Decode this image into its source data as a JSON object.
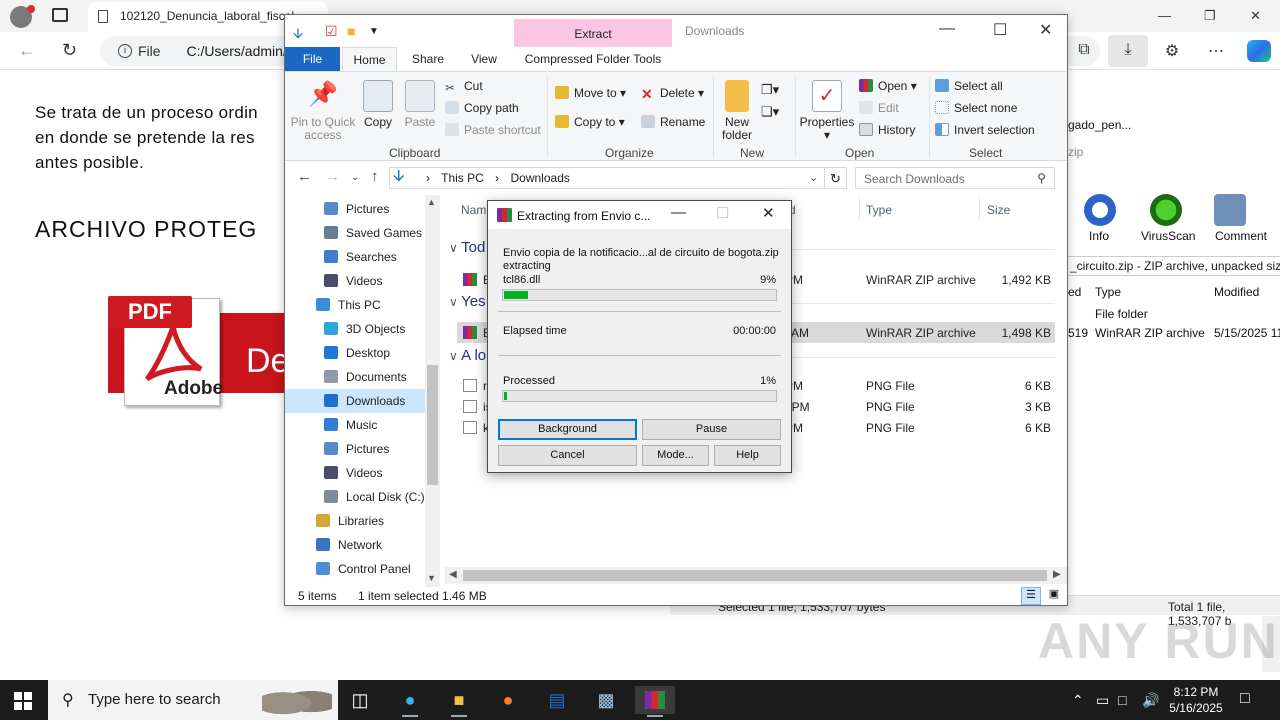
{
  "browser": {
    "tab_title": "102120_Denuncia_laboral_fiscal",
    "address_prefix": "File",
    "address": "C:/Users/admin/",
    "page_text_lines": [
      "Se trata de un proceso ordin",
      "en donde se pretende la res",
      "antes posible."
    ],
    "page_heading": "ARCHIVO PROTEG",
    "pdf_tag": "PDF",
    "pdf_band_text": "De",
    "adobe_label": "Adobe"
  },
  "winrar_bg": {
    "toolbar": [
      "Info",
      "VirusScan",
      "Comment"
    ],
    "path_text": "_circuito.zip - ZIP archive, unpacked size",
    "header_partial_left": "ed",
    "headers": [
      "Type",
      "Modified"
    ],
    "rows": [
      {
        "left": "",
        "type": "File folder",
        "modified": ""
      },
      {
        "left": "519",
        "type": "WinRAR ZIP archive",
        "modified": "5/15/2025 11"
      }
    ],
    "side_text_1": "gado_pen...",
    "side_text_2": "zip",
    "status_left": "Selected 1 file, 1,533,707 bytes",
    "status_right": "Total 1 file, 1,533,707 b"
  },
  "watermark": "ANY RUN",
  "explorer": {
    "context_tab": "Extract",
    "context_group": "Compressed Folder Tools",
    "title": "Downloads",
    "tabs": [
      "File",
      "Home",
      "Share",
      "View"
    ],
    "clipboard": {
      "pin": "Pin to Quick access",
      "copy": "Copy",
      "paste": "Paste",
      "cut": "Cut",
      "copy_path": "Copy path",
      "paste_shortcut": "Paste shortcut",
      "group": "Clipboard"
    },
    "organize": {
      "move_to": "Move to",
      "copy_to": "Copy to",
      "delete": "Delete",
      "rename": "Rename",
      "group": "Organize"
    },
    "new": {
      "new_folder": "New folder",
      "group": "New"
    },
    "open": {
      "properties": "Properties",
      "open": "Open",
      "edit": "Edit",
      "history": "History",
      "group": "Open"
    },
    "select": {
      "select_all": "Select all",
      "select_none": "Select none",
      "invert": "Invert selection",
      "group": "Select"
    },
    "breadcrumb": [
      "This PC",
      "Downloads"
    ],
    "search_placeholder": "Search Downloads",
    "nav": [
      {
        "label": "Pictures",
        "indent": 2,
        "color": "#5a8ac6"
      },
      {
        "label": "Saved Games",
        "indent": 2,
        "color": "#6a7c92"
      },
      {
        "label": "Searches",
        "indent": 2,
        "color": "#3f7bd1"
      },
      {
        "label": "Videos",
        "indent": 2,
        "color": "#4b4b6e"
      },
      {
        "label": "This PC",
        "indent": 1,
        "color": "#3a8fd8"
      },
      {
        "label": "3D Objects",
        "indent": 2,
        "color": "#2fa6d9"
      },
      {
        "label": "Desktop",
        "indent": 2,
        "color": "#1e78d6"
      },
      {
        "label": "Documents",
        "indent": 2,
        "color": "#8f9aa8"
      },
      {
        "label": "Downloads",
        "indent": 2,
        "color": "#1e6fd0",
        "selected": true
      },
      {
        "label": "Music",
        "indent": 2,
        "color": "#2f7fd4"
      },
      {
        "label": "Pictures",
        "indent": 2,
        "color": "#5a8ac6"
      },
      {
        "label": "Videos",
        "indent": 2,
        "color": "#4b4b6e"
      },
      {
        "label": "Local Disk (C:)",
        "indent": 2,
        "color": "#7d8a98"
      },
      {
        "label": "Libraries",
        "indent": 1,
        "color": "#d9a531"
      },
      {
        "label": "Network",
        "indent": 1,
        "color": "#3a73c4"
      },
      {
        "label": "Control Panel",
        "indent": 1,
        "color": "#4c8fd4"
      }
    ],
    "columns": [
      "Nam",
      "d",
      "Type",
      "Size"
    ],
    "groups": [
      {
        "label": "Tod"
      },
      {
        "label": "Yes"
      },
      {
        "label": "A lo"
      }
    ],
    "files": [
      {
        "name": "E",
        "date": "0 PM",
        "type": "WinRAR ZIP archive",
        "size": "1,492 KB",
        "icon": "rar",
        "group": 0
      },
      {
        "name": "E",
        "date": "09 AM",
        "type": "WinRAR ZIP archive",
        "size": "1,498 KB",
        "icon": "rar",
        "group": 1,
        "selected": true
      },
      {
        "name": "r",
        "date": "3 PM",
        "type": "PNG File",
        "size": "6 KB",
        "icon": "png",
        "group": 2
      },
      {
        "name": "is",
        "date": "32 PM",
        "type": "PNG File",
        "size": "3 KB",
        "icon": "png",
        "group": 2
      },
      {
        "name": "k",
        "date": "3 PM",
        "type": "PNG File",
        "size": "6 KB",
        "icon": "png",
        "group": 2
      }
    ],
    "status_items": "5 items",
    "status_selected": "1 item selected  1.46 MB"
  },
  "dialog": {
    "title": "Extracting from Envio c...",
    "archive": "Envio copia de la notificacio...al de circuito de bogota.zip",
    "action": "extracting",
    "current_file": "tcl86.dll",
    "file_percent_label": "9%",
    "file_progress": 0.09,
    "elapsed_label": "Elapsed time",
    "elapsed": "00:00:00",
    "processed_label": "Processed",
    "processed_percent_label": "1%",
    "processed_progress": 0.01,
    "buttons": {
      "background": "Background",
      "pause": "Pause",
      "cancel": "Cancel",
      "mode": "Mode...",
      "help": "Help"
    }
  },
  "taskbar": {
    "search_placeholder": "Type here to search",
    "time": "8:12 PM",
    "date": "5/16/2025"
  }
}
